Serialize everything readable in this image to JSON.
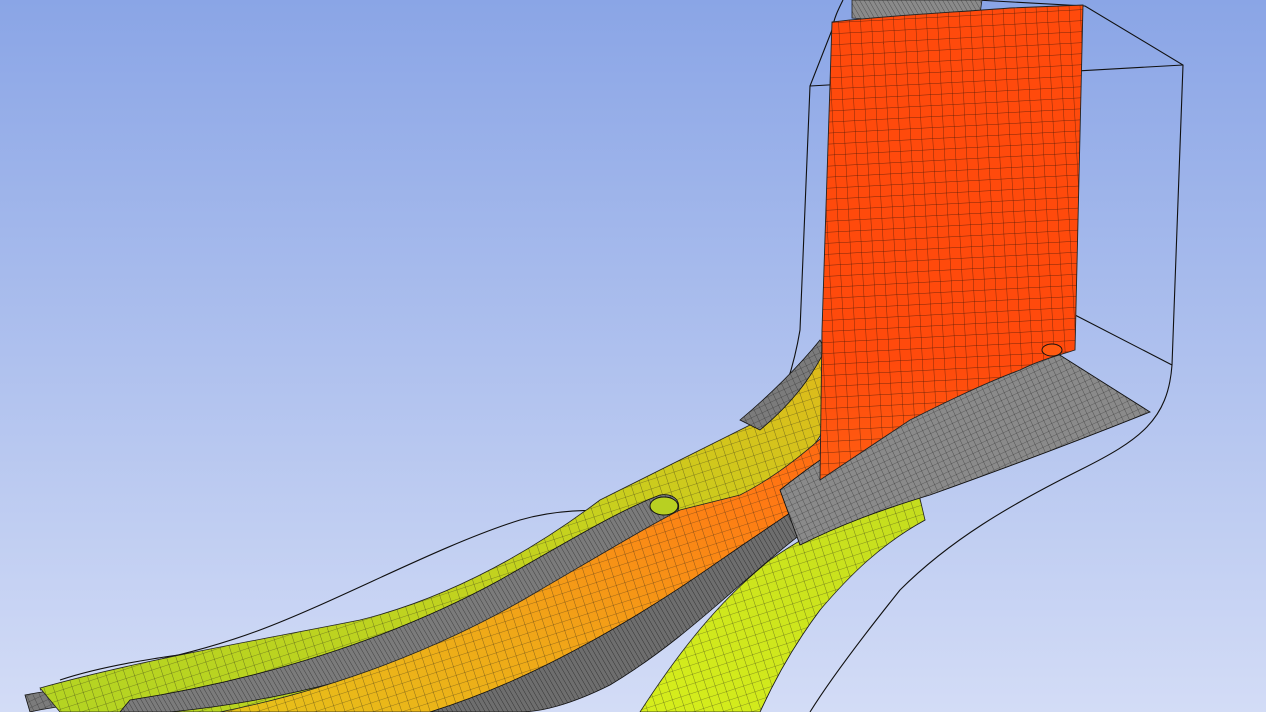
{
  "viewport": {
    "background_top": "#8aa5e6",
    "background_bottom": "#d3dcf6"
  },
  "colors": {
    "outline": "#101010",
    "mesh_line": "#1a1a1a",
    "shroud_grey": "#8a8a8a",
    "passage_grey": "#7b7b7b",
    "hot": "#ff4a0c",
    "warm": "#ff7a14",
    "mid": "#f0a818",
    "cool": "#b4d422",
    "cold": "#d6ee1c"
  }
}
